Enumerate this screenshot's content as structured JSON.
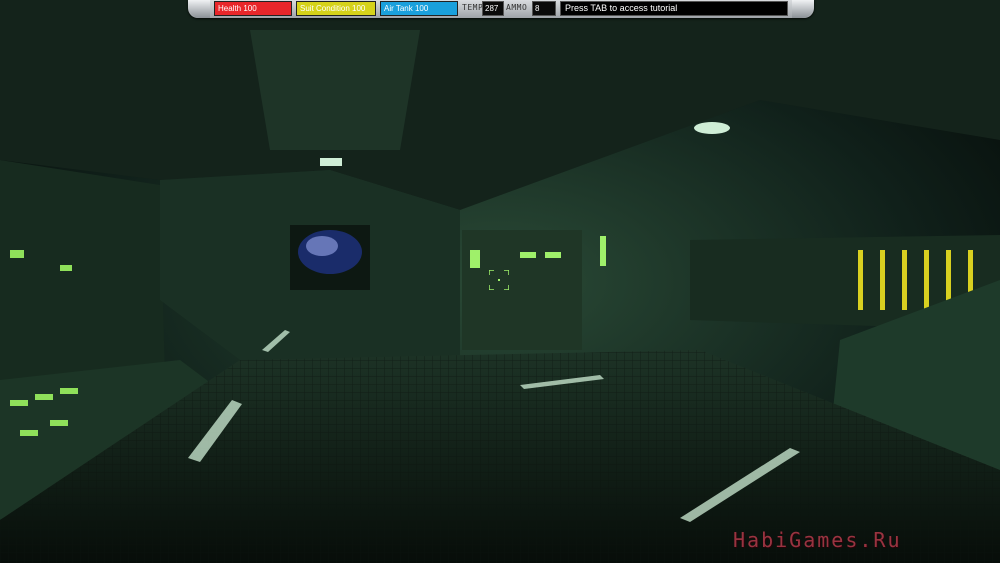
{
  "hud": {
    "health_label": "Health 100",
    "health_level": 1.0,
    "suit_label": "Suit Condition 100",
    "suit_level": 1.0,
    "air_label": "Air Tank 100",
    "air_level": 1.0,
    "temp_label": "TEMP",
    "temp_value": "287",
    "ammo_label": "AMMO",
    "ammo_value": "8",
    "tutorial_text": "Press TAB to access tutorial"
  },
  "colors": {
    "health": "#e8262a",
    "suit": "#d6d21a",
    "air": "#1aa0dc",
    "corridor_tint": "#1f3a2a",
    "light": "#cfeed6"
  },
  "watermark": "HabiGames.Ru"
}
